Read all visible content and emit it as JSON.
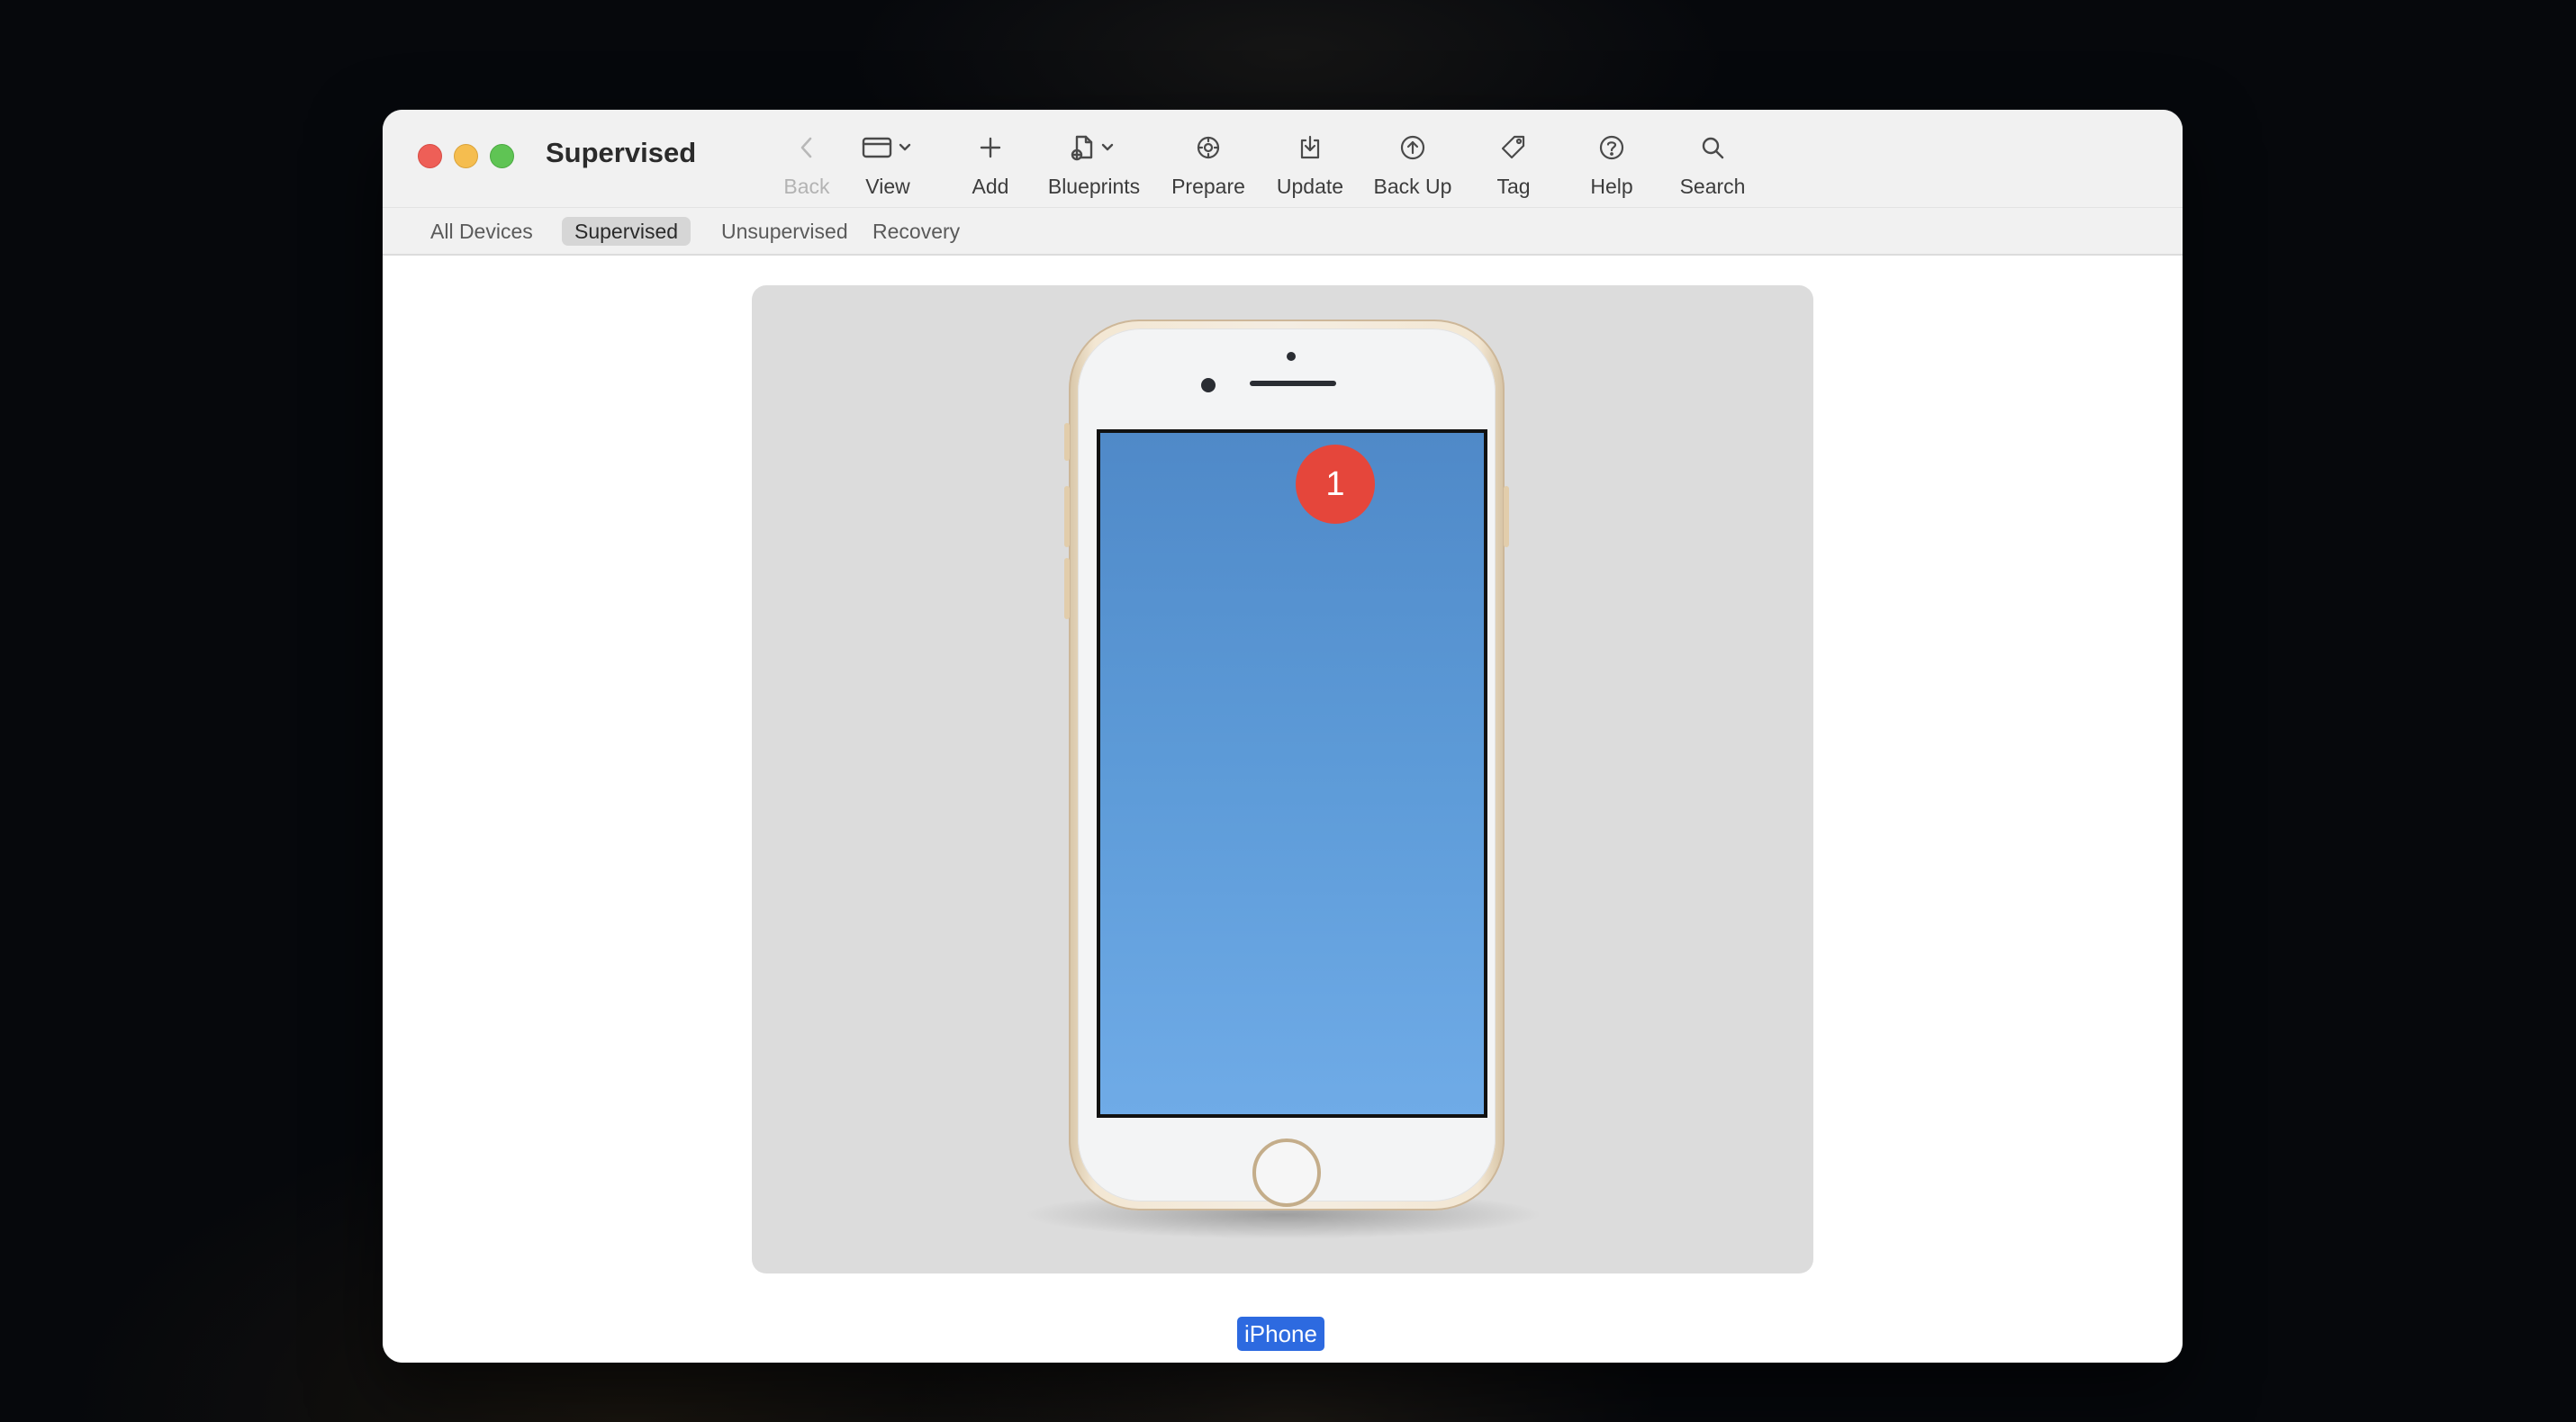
{
  "window": {
    "title": "Supervised"
  },
  "toolbar": {
    "back_label": "Back",
    "view_label": "View",
    "add_label": "Add",
    "blueprints_label": "Blueprints",
    "prepare_label": "Prepare",
    "update_label": "Update",
    "backup_label": "Back Up",
    "tag_label": "Tag",
    "help_label": "Help",
    "search_label": "Search"
  },
  "tabs": [
    {
      "label": "All Devices",
      "active": false
    },
    {
      "label": "Supervised",
      "active": true
    },
    {
      "label": "Unsupervised",
      "active": false
    },
    {
      "label": "Recovery",
      "active": false
    }
  ],
  "device": {
    "name": "iPhone",
    "badge_count": "1",
    "icon": "iphone-device-icon"
  },
  "colors": {
    "badge": "#e5463b",
    "selection": "#2d6ae0",
    "screen": "#5d9bd8"
  }
}
